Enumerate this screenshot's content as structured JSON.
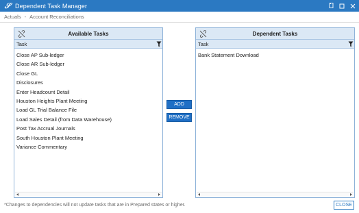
{
  "window": {
    "title": "Dependent Task Manager",
    "app_icon_glyph": "𝒮",
    "controls": [
      "restore-icon",
      "maximize-icon",
      "close-icon"
    ]
  },
  "breadcrumb": {
    "items": [
      "Actuals",
      "Account Reconciliations"
    ],
    "separator": "-"
  },
  "available_panel": {
    "title": "Available Tasks",
    "column_header": "Task",
    "items": [
      "Close AP Sub-ledger",
      "Close AR Sub-ledger",
      "Close GL",
      "Disclosures",
      "Enter Headcount Detail",
      "Houston Heights Plant Meeting",
      "Load GL Trial Balance File",
      "Load Sales Detail (from Data Warehouse)",
      "Post Tax Accrual Journals",
      "South Houston Plant Meeting",
      "Variance Commentary"
    ]
  },
  "dependent_panel": {
    "title": "Dependent Tasks",
    "column_header": "Task",
    "items": [
      "Bank Statement Download"
    ]
  },
  "actions": {
    "add_label": "ADD",
    "remove_label": "REMOVE",
    "close_label": "CLOSE"
  },
  "footnote": "*Changes to dependencies will not update tasks that are in Prepared states or higher.",
  "colors": {
    "titlebar": "#2b79c2",
    "panel_header": "#dbe8f5",
    "button_blue": "#1f6fc5"
  }
}
